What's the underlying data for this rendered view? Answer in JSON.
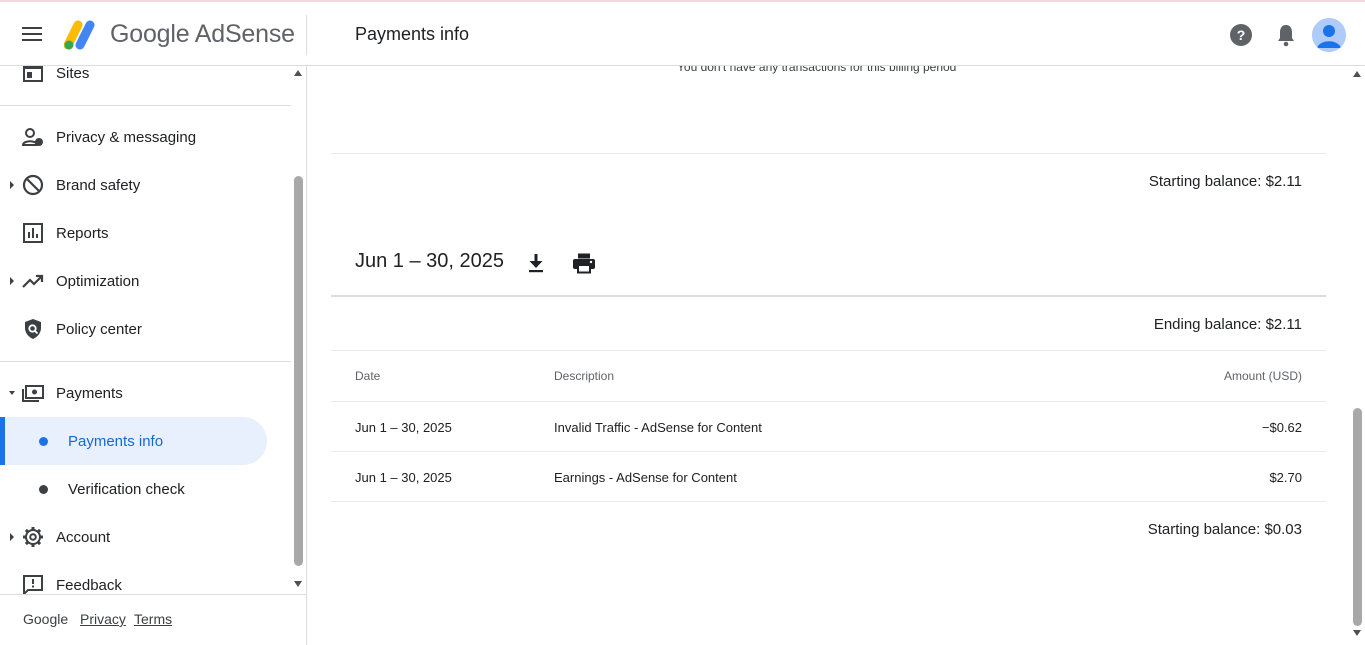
{
  "header": {
    "brand": "Google AdSense",
    "page_title": "Payments info"
  },
  "sidebar": {
    "items": [
      {
        "label": "Sites",
        "icon": "sites-icon"
      },
      {
        "label": "Privacy & messaging",
        "icon": "privacy-messaging-icon"
      },
      {
        "label": "Brand safety",
        "icon": "block-icon"
      },
      {
        "label": "Reports",
        "icon": "reports-icon"
      },
      {
        "label": "Optimization",
        "icon": "trending-up-icon"
      },
      {
        "label": "Policy center",
        "icon": "policy-shield-icon"
      },
      {
        "label": "Payments",
        "icon": "payments-icon"
      },
      {
        "label": "Account",
        "icon": "gear-icon"
      },
      {
        "label": "Feedback",
        "icon": "feedback-icon"
      }
    ],
    "payments_sub": [
      {
        "label": "Payments info",
        "active": true
      },
      {
        "label": "Verification check",
        "active": false
      }
    ],
    "footer": {
      "google": "Google",
      "privacy": "Privacy",
      "terms": "Terms"
    }
  },
  "main": {
    "no_transactions": "You don't have any transactions for this billing period",
    "prev_starting_balance": "Starting balance: $2.11",
    "period": {
      "title": "Jun 1 – 30, 2025",
      "ending_balance": "Ending balance: $2.11",
      "columns": [
        "Date",
        "Description",
        "Amount (USD)"
      ],
      "rows": [
        {
          "date": "Jun 1 – 30, 2025",
          "description": "Invalid Traffic - AdSense for Content",
          "amount": "−$0.62"
        },
        {
          "date": "Jun 1 – 30, 2025",
          "description": "Earnings - AdSense for Content",
          "amount": "$2.70"
        }
      ],
      "starting_balance": "Starting balance: $0.03"
    }
  },
  "colors": {
    "accent": "#1a73e8",
    "active_bg": "#e8f0fe",
    "text": "#202124",
    "muted": "#5f6368"
  }
}
